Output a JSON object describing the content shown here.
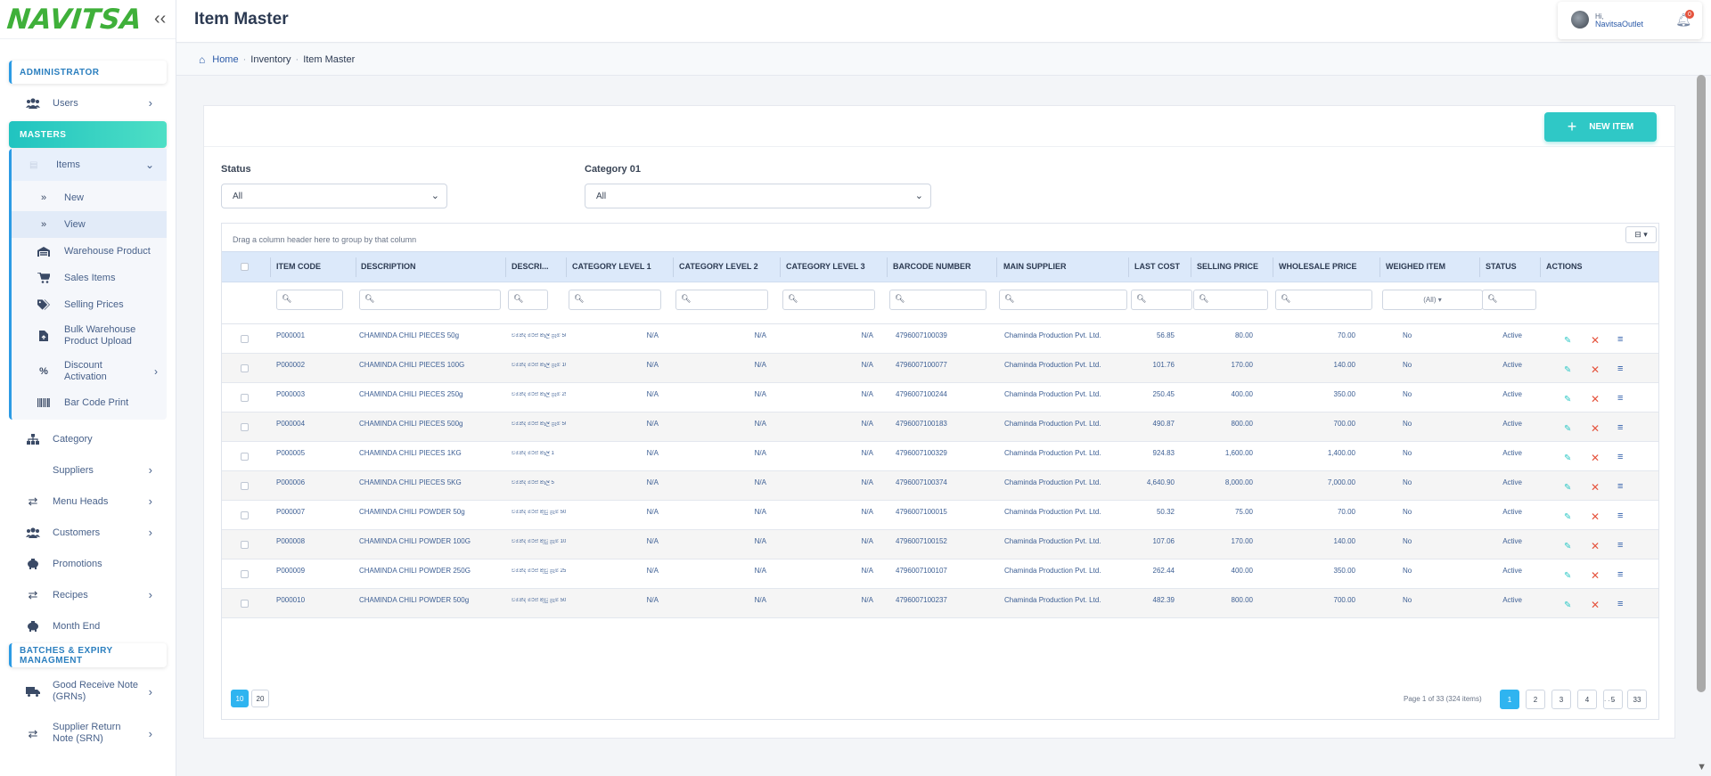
{
  "app": {
    "logo": "NAVITSA",
    "page_title": "Item Master"
  },
  "user": {
    "greeting": "Hi,",
    "name": "NavitsaOutlet",
    "notifications": "0"
  },
  "breadcrumb": {
    "home": "Home",
    "section": "Inventory",
    "current": "Item Master"
  },
  "sidebar": {
    "admin_header": "ADMINISTRATOR",
    "users": "Users",
    "masters_header": "MASTERS",
    "items": "Items",
    "items_sub": [
      {
        "label": "New",
        "icon": "double-chevron-right-icon"
      },
      {
        "label": "View",
        "icon": "double-chevron-right-icon"
      },
      {
        "label": "Warehouse Product",
        "icon": "warehouse-icon"
      },
      {
        "label": "Sales Items",
        "icon": "cart-icon"
      },
      {
        "label": "Selling Prices",
        "icon": "tags-icon"
      },
      {
        "label": "Bulk Warehouse Product Upload",
        "icon": "file-upload-icon"
      },
      {
        "label": "Discount Activation",
        "icon": "percent-icon"
      },
      {
        "label": "Bar Code Print",
        "icon": "barcode-icon"
      }
    ],
    "category": "Category",
    "suppliers": "Suppliers",
    "menu_heads": "Menu Heads",
    "customers": "Customers",
    "promotions": "Promotions",
    "recipes": "Recipes",
    "month_end": "Month End",
    "batches_header": "BATCHES & EXPIRY MANAGMENT",
    "grn": "Good Receive Note (GRNs)",
    "srn": "Supplier Return Note (SRN)"
  },
  "toolbar": {
    "new_item": "NEW ITEM"
  },
  "filters": {
    "status_label": "Status",
    "status_value": "All",
    "category_label": "Category 01",
    "category_value": "All"
  },
  "grid": {
    "group_hint": "Drag a column header here to group by that column",
    "columns": [
      "ITEM CODE",
      "DESCRIPTION",
      "DESCRI...",
      "CATEGORY LEVEL 1",
      "CATEGORY LEVEL 2",
      "CATEGORY LEVEL 3",
      "BARCODE NUMBER",
      "MAIN SUPPLIER",
      "LAST COST",
      "SELLING PRICE",
      "WHOLESALE PRICE",
      "WEIGHED ITEM",
      "STATUS",
      "ACTIONS"
    ],
    "weighed_filter": "(All)",
    "rows": [
      {
        "code": "P000001",
        "desc": "CHAMINDA CHILI PIECES 50g",
        "desc2": "චමින්ද මිරිස් කෑලි ග්‍රෑම් 50",
        "c1": "N/A",
        "c2": "N/A",
        "c3": "N/A",
        "barcode": "4796007100039",
        "supplier": "Chaminda Production Pvt. Ltd.",
        "cost": "56.85",
        "sell": "80.00",
        "whole": "70.00",
        "weighed": "No",
        "status": "Active"
      },
      {
        "code": "P000002",
        "desc": "CHAMINDA CHILI PIECES 100G",
        "desc2": "චමින්ද මිරිස් කෑලි ග්‍රෑම් 100",
        "c1": "N/A",
        "c2": "N/A",
        "c3": "N/A",
        "barcode": "4796007100077",
        "supplier": "Chaminda Production Pvt. Ltd.",
        "cost": "101.76",
        "sell": "170.00",
        "whole": "140.00",
        "weighed": "No",
        "status": "Active"
      },
      {
        "code": "P000003",
        "desc": "CHAMINDA CHILI PIECES 250g",
        "desc2": "චමින්ද මිරිස් කෑලි ග්‍රෑම් 250",
        "c1": "N/A",
        "c2": "N/A",
        "c3": "N/A",
        "barcode": "4796007100244",
        "supplier": "Chaminda Production Pvt. Ltd.",
        "cost": "250.45",
        "sell": "400.00",
        "whole": "350.00",
        "weighed": "No",
        "status": "Active"
      },
      {
        "code": "P000004",
        "desc": "CHAMINDA CHILI PIECES 500g",
        "desc2": "චමින්ද මිරිස් කෑලි ග්‍රෑම් 500",
        "c1": "N/A",
        "c2": "N/A",
        "c3": "N/A",
        "barcode": "4796007100183",
        "supplier": "Chaminda Production Pvt. Ltd.",
        "cost": "490.87",
        "sell": "800.00",
        "whole": "700.00",
        "weighed": "No",
        "status": "Active"
      },
      {
        "code": "P000005",
        "desc": "CHAMINDA CHILI PIECES 1KG",
        "desc2": "චමින්ද මිරිස් කෑලි 1",
        "c1": "N/A",
        "c2": "N/A",
        "c3": "N/A",
        "barcode": "4796007100329",
        "supplier": "Chaminda Production Pvt. Ltd.",
        "cost": "924.83",
        "sell": "1,600.00",
        "whole": "1,400.00",
        "weighed": "No",
        "status": "Active"
      },
      {
        "code": "P000006",
        "desc": "CHAMINDA CHILI PIECES 5KG",
        "desc2": "චමින්ද මිරිස් කෑලි 5",
        "c1": "N/A",
        "c2": "N/A",
        "c3": "N/A",
        "barcode": "4796007100374",
        "supplier": "Chaminda Production Pvt. Ltd.",
        "cost": "4,640.90",
        "sell": "8,000.00",
        "whole": "7,000.00",
        "weighed": "No",
        "status": "Active"
      },
      {
        "code": "P000007",
        "desc": "CHAMINDA CHILI POWDER 50g",
        "desc2": "චමින්ද මිරිස් කුඩු ග්‍රෑම් 50",
        "c1": "N/A",
        "c2": "N/A",
        "c3": "N/A",
        "barcode": "4796007100015",
        "supplier": "Chaminda Production Pvt. Ltd.",
        "cost": "50.32",
        "sell": "75.00",
        "whole": "70.00",
        "weighed": "No",
        "status": "Active"
      },
      {
        "code": "P000008",
        "desc": "CHAMINDA CHILI POWDER 100G",
        "desc2": "චමින්ද මිරිස් කුඩු ග්‍රෑම් 100",
        "c1": "N/A",
        "c2": "N/A",
        "c3": "N/A",
        "barcode": "4796007100152",
        "supplier": "Chaminda Production Pvt. Ltd.",
        "cost": "107.06",
        "sell": "170.00",
        "whole": "140.00",
        "weighed": "No",
        "status": "Active"
      },
      {
        "code": "P000009",
        "desc": "CHAMINDA CHILI POWDER 250G",
        "desc2": "චමින්ද මිරිස් කුඩු ග්‍රෑම් 250",
        "c1": "N/A",
        "c2": "N/A",
        "c3": "N/A",
        "barcode": "4796007100107",
        "supplier": "Chaminda Production Pvt. Ltd.",
        "cost": "262.44",
        "sell": "400.00",
        "whole": "350.00",
        "weighed": "No",
        "status": "Active"
      },
      {
        "code": "P000010",
        "desc": "CHAMINDA CHILI POWDER 500g",
        "desc2": "චමින්ද මිරිස් කුඩු ග්‍රෑම් 500",
        "c1": "N/A",
        "c2": "N/A",
        "c3": "N/A",
        "barcode": "4796007100237",
        "supplier": "Chaminda Production Pvt. Ltd.",
        "cost": "482.39",
        "sell": "800.00",
        "whole": "700.00",
        "weighed": "No",
        "status": "Active"
      }
    ]
  },
  "pager": {
    "sizes": [
      "10",
      "20"
    ],
    "info": "Page 1 of 33 (324 items)",
    "pages": [
      "1",
      "2",
      "3",
      "4",
      "5"
    ],
    "dots": ". . .",
    "last": "33"
  },
  "colors": {
    "accent": "#2fc8c6",
    "link": "#2b5aa8",
    "pager_active": "#2fb4f0",
    "danger": "#e5533d",
    "logo": "#3fb03a"
  }
}
